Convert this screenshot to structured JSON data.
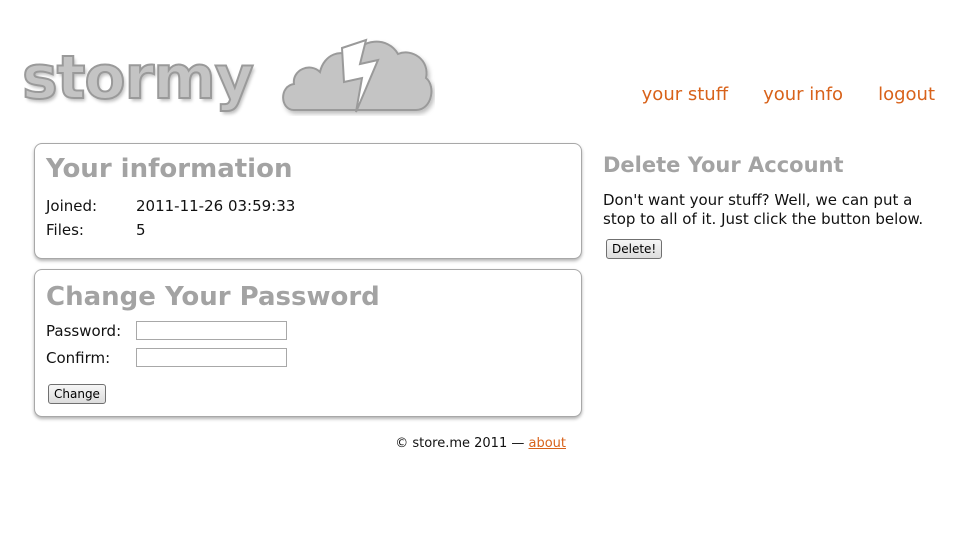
{
  "brand": {
    "name": "stormy"
  },
  "nav": {
    "items": [
      {
        "label": "your stuff"
      },
      {
        "label": "your info"
      },
      {
        "label": "logout"
      }
    ]
  },
  "info": {
    "title": "Your information",
    "joined_label": "Joined:",
    "joined_value": "2011-11-26 03:59:33",
    "files_label": "Files:",
    "files_value": "5"
  },
  "password": {
    "title": "Change Your Password",
    "password_label": "Password:",
    "password_value": "",
    "confirm_label": "Confirm:",
    "confirm_value": "",
    "change_label": "Change"
  },
  "delete": {
    "title": "Delete Your Account",
    "text": "Don't want your stuff? Well, we can put a stop to all of it. Just click the button below.",
    "button_label": "Delete!"
  },
  "footer": {
    "copyright": "© store.me 2011 —",
    "about_label": "about"
  },
  "colors": {
    "accent": "#d8621a",
    "heading_gray": "#a3a3a3",
    "logo_gray": "#c4c4c4"
  }
}
